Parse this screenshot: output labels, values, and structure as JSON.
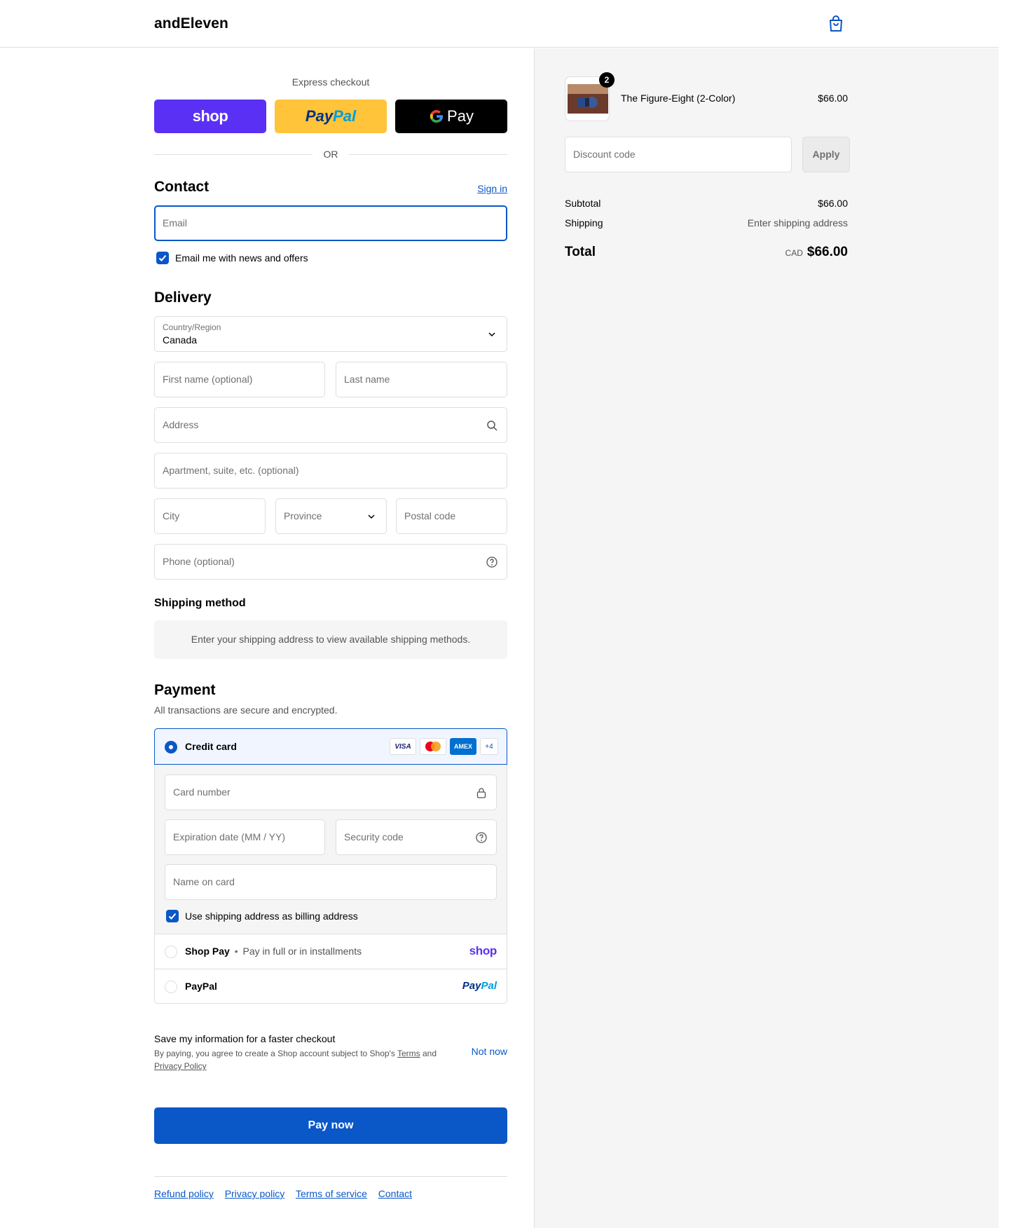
{
  "header": {
    "brand": "andEleven"
  },
  "express": {
    "title": "Express checkout",
    "shop_label": "shop",
    "paypal_label_a": "Pay",
    "paypal_label_b": "Pal",
    "gpay_label": "Pay",
    "or_label": "OR"
  },
  "contact": {
    "title": "Contact",
    "sign_in": "Sign in",
    "email_placeholder": "Email",
    "newsletter_label": "Email me with news and offers"
  },
  "delivery": {
    "title": "Delivery",
    "country_label": "Country/Region",
    "country_value": "Canada",
    "first_name": "First name (optional)",
    "last_name": "Last name",
    "address": "Address",
    "apartment": "Apartment, suite, etc. (optional)",
    "city": "City",
    "province": "Province",
    "postal": "Postal code",
    "phone": "Phone (optional)"
  },
  "shipping": {
    "title": "Shipping method",
    "notice": "Enter your shipping address to view available shipping methods."
  },
  "payment": {
    "title": "Payment",
    "subtitle": "All transactions are secure and encrypted.",
    "credit_card": "Credit card",
    "card_logos": [
      "VISA",
      "AMEX",
      "+4"
    ],
    "card_number": "Card number",
    "expiry": "Expiration date (MM / YY)",
    "security": "Security code",
    "name_on_card": "Name on card",
    "billing_same": "Use shipping address as billing address",
    "shop_pay": "Shop Pay",
    "shop_pay_sep": "•",
    "shop_pay_desc": "Pay in full or in installments",
    "shop_logo": "shop",
    "paypal": "PayPal",
    "paypal_logo_a": "Pay",
    "paypal_logo_b": "Pal"
  },
  "save_info": {
    "title": "Save my information for a faster checkout",
    "text_a": "By paying, you agree to create a Shop account subject to Shop's",
    "terms": "Terms",
    "and": "and",
    "privacy": "Privacy Policy",
    "not_now": "Not now"
  },
  "pay_now": "Pay now",
  "footer": {
    "links": [
      "Refund policy",
      "Privacy policy",
      "Terms of service",
      "Contact"
    ]
  },
  "summary": {
    "item_name": "The Figure-Eight (2-Color)",
    "item_qty": "2",
    "item_price": "$66.00",
    "discount_placeholder": "Discount code",
    "apply": "Apply",
    "subtotal_label": "Subtotal",
    "subtotal_value": "$66.00",
    "shipping_label": "Shipping",
    "shipping_value": "Enter shipping address",
    "total_label": "Total",
    "currency": "CAD",
    "total_value": "$66.00"
  },
  "colors": {
    "accent": "#0a57c7",
    "shop": "#5a31f4",
    "paypal": "#ffc439"
  }
}
